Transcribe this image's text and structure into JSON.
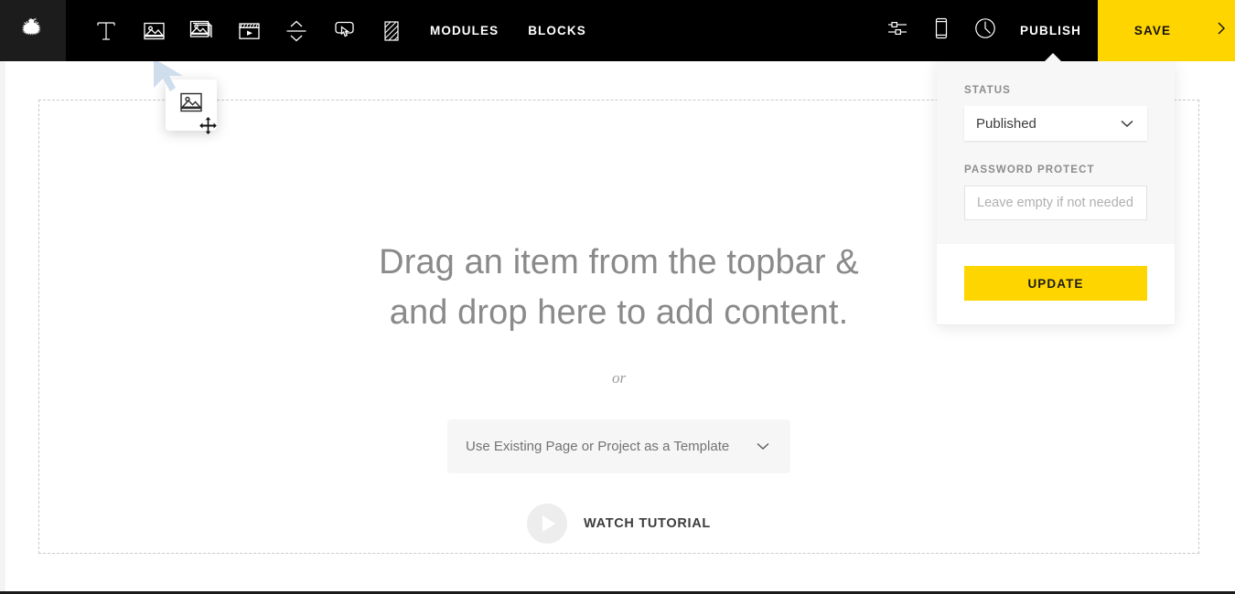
{
  "topbar": {
    "logo_icon": "eagle-logo-icon",
    "tools": [
      {
        "name": "text-tool",
        "icon": "text-icon",
        "label": "Text"
      },
      {
        "name": "image-tool",
        "icon": "image-icon",
        "label": "Image"
      },
      {
        "name": "gallery-tool",
        "icon": "gallery-icon",
        "label": "Gallery"
      },
      {
        "name": "video-tool",
        "icon": "video-icon",
        "label": "Video"
      },
      {
        "name": "spacer-tool",
        "icon": "spacer-icon",
        "label": "Spacer"
      },
      {
        "name": "button-tool",
        "icon": "button-click-icon",
        "label": "Button"
      },
      {
        "name": "divider-tool",
        "icon": "hatch-block-icon",
        "label": "Block"
      }
    ],
    "modules_label": "MODULES",
    "blocks_label": "BLOCKS",
    "right_icons": [
      {
        "name": "settings-sliders-icon",
        "label": "Settings"
      },
      {
        "name": "mobile-device-icon",
        "label": "Responsive"
      },
      {
        "name": "history-clock-icon",
        "label": "History"
      }
    ],
    "publish_label": "PUBLISH",
    "save_label": "SAVE",
    "more_arrow_icon": "chevron-right-icon",
    "accent_color": "#ffd500",
    "bar_color": "#000000",
    "logo_bg_color": "#1c1c1c"
  },
  "publish_panel": {
    "status_label": "STATUS",
    "status_value": "Published",
    "status_chevron_icon": "chevron-down-icon",
    "password_label": "PASSWORD PROTECT",
    "password_value": "",
    "password_placeholder": "Leave empty if not needed",
    "update_label": "UPDATE",
    "panel_bg_top": "#f7f7f7",
    "panel_bg_bottom": "#ffffff"
  },
  "canvas": {
    "headline_line1": "Drag an item from the topbar &",
    "headline_line2": "and drop here to add content.",
    "or_text": "or",
    "template_select_value": "Use Existing Page or Project as a Template",
    "template_chevron_icon": "chevron-down-icon",
    "watch_tutorial_label": "WATCH TUTORIAL",
    "play_icon": "play-triangle-icon",
    "dropzone_border": "dashed"
  },
  "drag": {
    "ghost_icon": "image-icon",
    "cursor_icon": "arrow-pointer-icon",
    "move_icon": "move-cross-icon"
  }
}
